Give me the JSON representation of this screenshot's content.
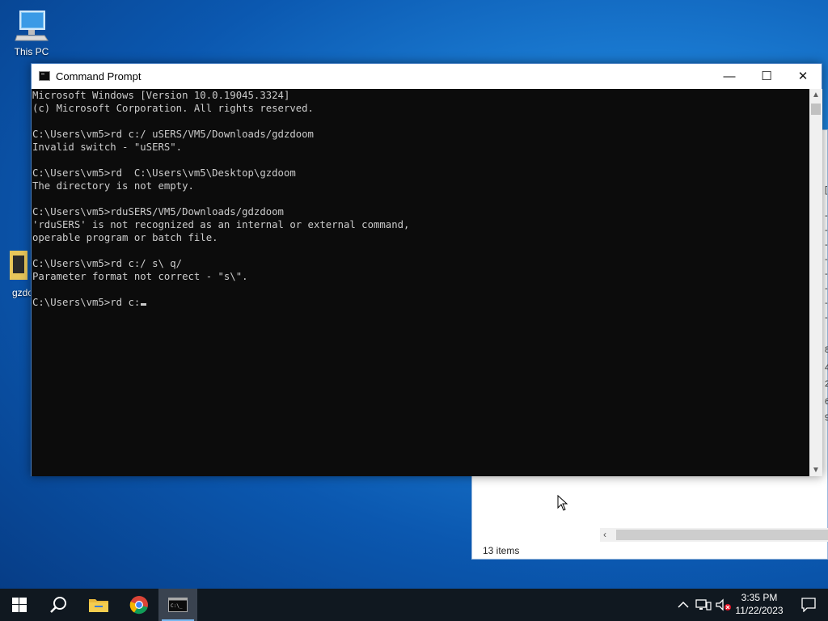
{
  "desktop": {
    "icons": [
      {
        "label": "This PC"
      },
      {
        "label": "gzdo"
      }
    ]
  },
  "explorer": {
    "status_items": "13 items",
    "fragments": [
      "[",
      "-",
      "-",
      "-",
      "-",
      "-",
      "-",
      "-",
      "-",
      "8",
      "4",
      "2",
      "6",
      "9"
    ]
  },
  "cmd": {
    "title": "Command Prompt",
    "minimize": "—",
    "maximize": "☐",
    "close": "✕",
    "lines": [
      "Microsoft Windows [Version 10.0.19045.3324]",
      "(c) Microsoft Corporation. All rights reserved.",
      "",
      "C:\\Users\\vm5>rd c:/ uSERS/VM5/Downloads/gdzdoom",
      "Invalid switch - \"uSERS\".",
      "",
      "C:\\Users\\vm5>rd  C:\\Users\\vm5\\Desktop\\gzdoom",
      "The directory is not empty.",
      "",
      "C:\\Users\\vm5>rduSERS/VM5/Downloads/gdzdoom",
      "'rduSERS' is not recognized as an internal or external command,",
      "operable program or batch file.",
      "",
      "C:\\Users\\vm5>rd c:/ s\\ q/",
      "Parameter format not correct - \"s\\\".",
      ""
    ],
    "current_input": "C:\\Users\\vm5>rd c:"
  },
  "taskbar": {
    "clock_time": "3:35 PM",
    "clock_date": "11/22/2023",
    "apps": [
      "start-icon",
      "search-icon",
      "file-explorer-icon",
      "chrome-icon",
      "cmd-icon"
    ]
  }
}
